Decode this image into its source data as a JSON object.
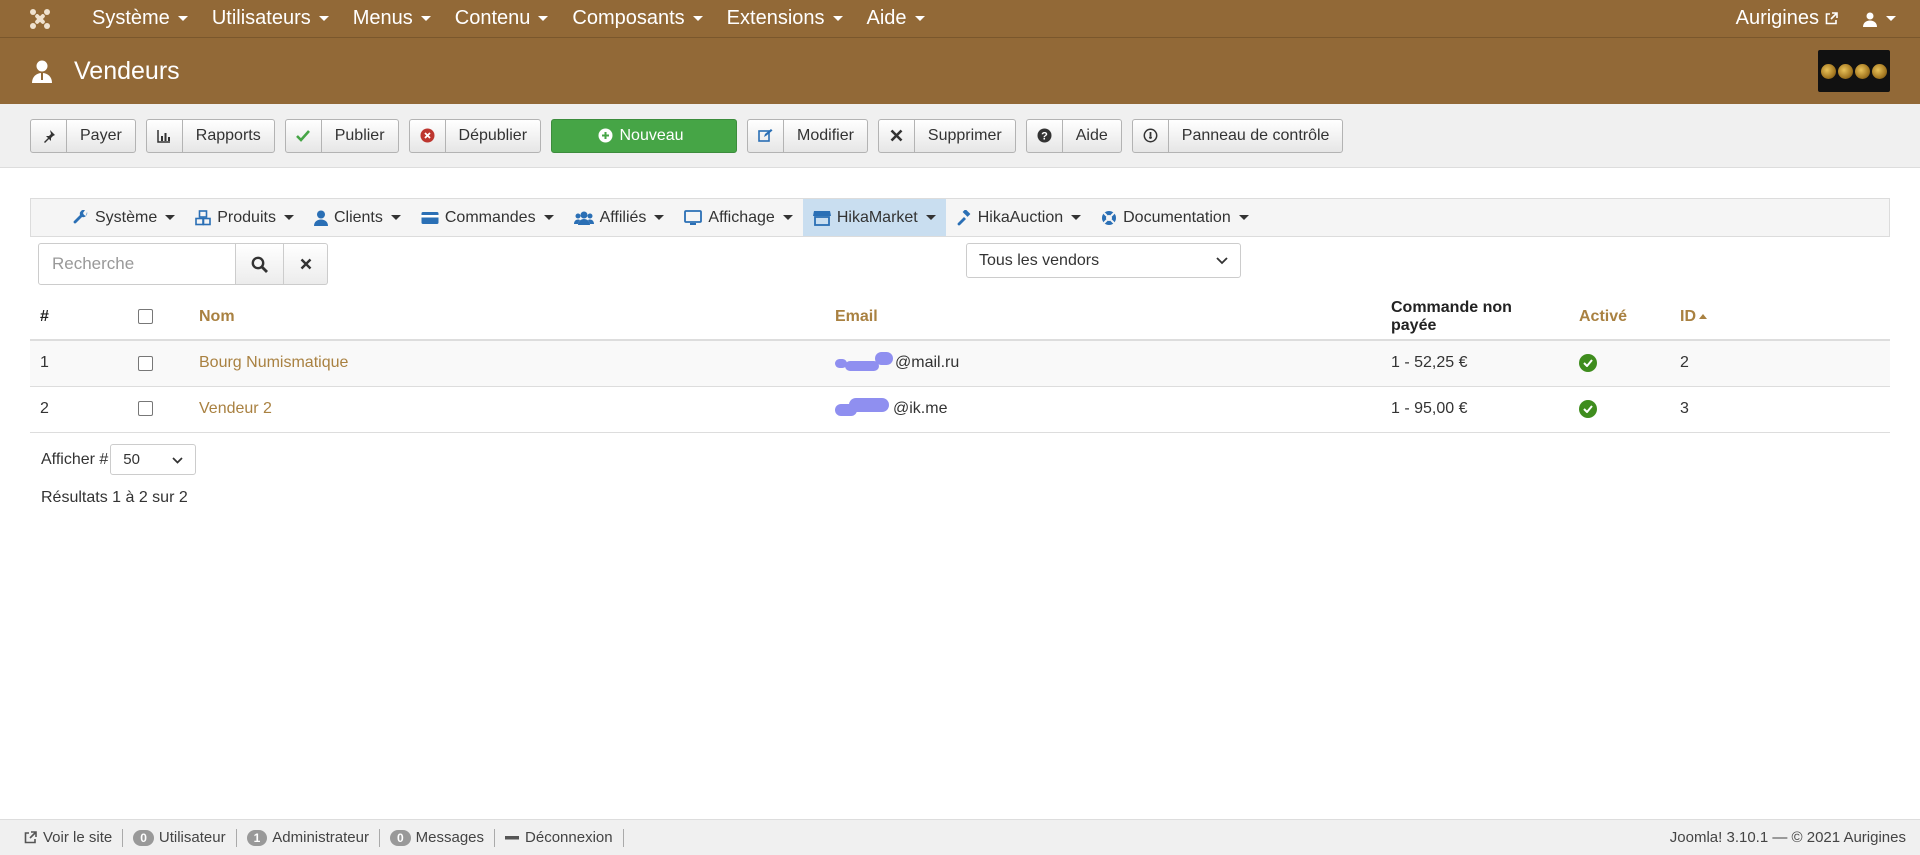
{
  "topbar": {
    "menu": [
      {
        "label": "Système"
      },
      {
        "label": "Utilisateurs"
      },
      {
        "label": "Menus"
      },
      {
        "label": "Contenu"
      },
      {
        "label": "Composants"
      },
      {
        "label": "Extensions"
      },
      {
        "label": "Aide"
      }
    ],
    "site_name": "Aurigines"
  },
  "page": {
    "title": "Vendeurs"
  },
  "toolbar": {
    "pay": "Payer",
    "reports": "Rapports",
    "publish": "Publier",
    "unpublish": "Dépublier",
    "new": "Nouveau",
    "edit": "Modifier",
    "delete": "Supprimer",
    "help": "Aide",
    "control_panel": "Panneau de contrôle"
  },
  "submenu": [
    {
      "label": "Système"
    },
    {
      "label": "Produits"
    },
    {
      "label": "Clients"
    },
    {
      "label": "Commandes"
    },
    {
      "label": "Affiliés"
    },
    {
      "label": "Affichage"
    },
    {
      "label": "HikaMarket"
    },
    {
      "label": "HikaAuction"
    },
    {
      "label": "Documentation"
    }
  ],
  "filters": {
    "search_placeholder": "Recherche",
    "vendor_filter": "Tous les vendors"
  },
  "table": {
    "headers": {
      "num": "#",
      "name": "Nom",
      "email": "Email",
      "unpaid": "Commande non payée",
      "active": "Activé",
      "id": "ID"
    },
    "rows": [
      {
        "num": "1",
        "name": "Bourg Numismatique",
        "email_visible": "@mail.ru",
        "unpaid": "1 - 52,25 €",
        "id": "2"
      },
      {
        "num": "2",
        "name": "Vendeur 2",
        "email_visible": "@ik.me",
        "unpaid": "1 - 95,00 €",
        "id": "3"
      }
    ]
  },
  "pagination": {
    "label": "Afficher #",
    "limit": "50",
    "results": "Résultats 1 à 2 sur 2"
  },
  "statusbar": {
    "view_site": "Voir le site",
    "visitors_count": "0",
    "visitors_label": "Utilisateur",
    "admins_count": "1",
    "admins_label": "Administrateur",
    "messages_count": "0",
    "messages_label": "Messages",
    "logout": "Déconnexion",
    "version": "Joomla! 3.10.1  —  © 2021 Aurigines"
  },
  "colors": {
    "header_brown": "#926937",
    "link_gold": "#a98141",
    "new_green": "#46a546",
    "active_green": "#3f8d1e",
    "submenu_active": "#c9def0",
    "icon_blue": "#2a6fb5"
  },
  "icons": [
    "joomla-icon",
    "external-link-icon",
    "user-icon",
    "pushpin-icon",
    "bar-chart-icon",
    "check-icon",
    "remove-circle-icon",
    "plus-circle-icon",
    "edit-icon",
    "x-icon",
    "question-icon",
    "dashboard-icon",
    "wrench-icon",
    "cubes-icon",
    "users-icon",
    "credit-card-icon",
    "monitor-icon",
    "store-icon",
    "gavel-icon",
    "life-ring-icon",
    "search-icon",
    "minus-icon"
  ]
}
